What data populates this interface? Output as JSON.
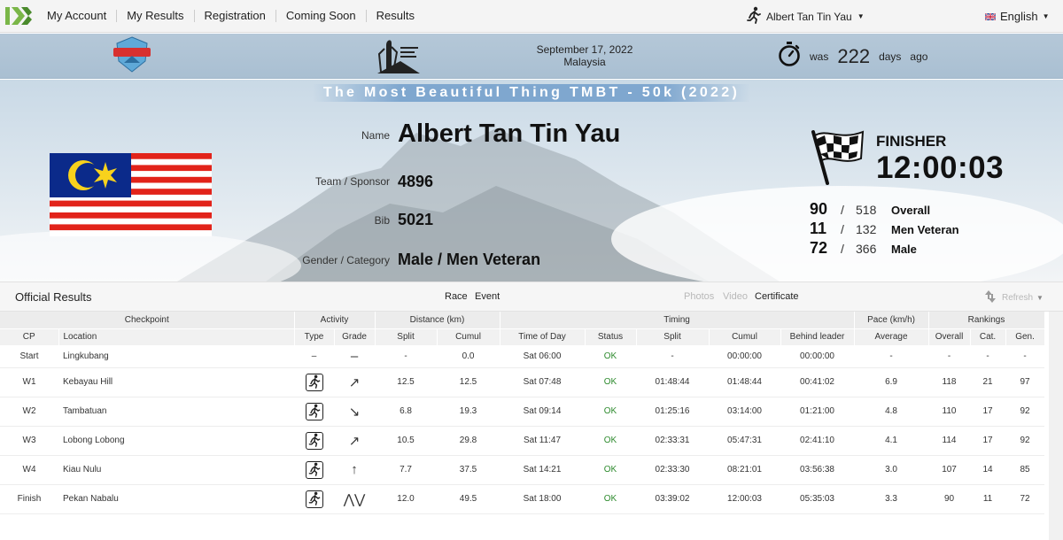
{
  "nav": {
    "items": [
      "My Account",
      "My Results",
      "Registration",
      "Coming Soon",
      "Results"
    ],
    "user_name": "Albert Tan Tin Yau",
    "language": "English"
  },
  "header": {
    "date": "September 17, 2022",
    "country": "Malaysia",
    "was_label": "was",
    "days_count": "222",
    "days_label": "days",
    "ago_label": "ago"
  },
  "event_title": "The Most Beautiful Thing TMBT - 50k (2022)",
  "runner": {
    "name_label": "Name",
    "name": "Albert Tan Tin Yau",
    "team_label": "Team / Sponsor",
    "team": "4896",
    "bib_label": "Bib",
    "bib": "5021",
    "gender_label": "Gender / Category",
    "gender": "Male / Men Veteran"
  },
  "finish": {
    "status": "FINISHER",
    "time": "12:00:03",
    "rankings": [
      {
        "pos": "90",
        "total": "518",
        "category": "Overall"
      },
      {
        "pos": "11",
        "total": "132",
        "category": "Men Veteran"
      },
      {
        "pos": "72",
        "total": "366",
        "category": "Male"
      }
    ]
  },
  "results_bar": {
    "title": "Official Results",
    "tab_race": "Race",
    "tab_event": "Event",
    "tab_photos": "Photos",
    "tab_video": "Video",
    "tab_certificate": "Certificate",
    "refresh": "Refresh"
  },
  "table": {
    "group_headers": [
      "Checkpoint",
      "Activity",
      "Distance (km)",
      "Timing",
      "Pace (km/h)",
      "Rankings"
    ],
    "columns": [
      "CP",
      "Location",
      "Type",
      "Grade",
      "Split",
      "Cumul",
      "Time of Day",
      "Status",
      "Split",
      "Cumul",
      "Behind leader",
      "Average",
      "Overall",
      "Cat.",
      "Gen."
    ],
    "rows": [
      {
        "cp": "Start",
        "location": "Lingkubang",
        "type": "–",
        "grade": "–",
        "dist_split": "-",
        "dist_cumul": "0.0",
        "tod": "Sat 06:00",
        "status": "OK",
        "split": "-",
        "cumul": "00:00:00",
        "behind": "00:00:00",
        "pace": "-",
        "overall": "-",
        "cat": "-",
        "gen": "-"
      },
      {
        "cp": "W1",
        "location": "Kebayau Hill",
        "type": "runner-icon",
        "grade": "↗",
        "dist_split": "12.5",
        "dist_cumul": "12.5",
        "tod": "Sat 07:48",
        "status": "OK",
        "split": "01:48:44",
        "cumul": "01:48:44",
        "behind": "00:41:02",
        "pace": "6.9",
        "overall": "118",
        "cat": "21",
        "gen": "97"
      },
      {
        "cp": "W2",
        "location": "Tambatuan",
        "type": "runner-icon",
        "grade": "↘",
        "dist_split": "6.8",
        "dist_cumul": "19.3",
        "tod": "Sat 09:14",
        "status": "OK",
        "split": "01:25:16",
        "cumul": "03:14:00",
        "behind": "01:21:00",
        "pace": "4.8",
        "overall": "110",
        "cat": "17",
        "gen": "92"
      },
      {
        "cp": "W3",
        "location": "Lobong Lobong",
        "type": "runner-icon",
        "grade": "↗",
        "dist_split": "10.5",
        "dist_cumul": "29.8",
        "tod": "Sat 11:47",
        "status": "OK",
        "split": "02:33:31",
        "cumul": "05:47:31",
        "behind": "02:41:10",
        "pace": "4.1",
        "overall": "114",
        "cat": "17",
        "gen": "92"
      },
      {
        "cp": "W4",
        "location": "Kiau Nulu",
        "type": "runner-icon",
        "grade": "↑",
        "dist_split": "7.7",
        "dist_cumul": "37.5",
        "tod": "Sat 14:21",
        "status": "OK",
        "split": "02:33:30",
        "cumul": "08:21:01",
        "behind": "03:56:38",
        "pace": "3.0",
        "overall": "107",
        "cat": "14",
        "gen": "85"
      },
      {
        "cp": "Finish",
        "location": "Pekan Nabalu",
        "type": "runner-icon",
        "grade": "⋀⋁",
        "dist_split": "12.0",
        "dist_cumul": "49.5",
        "tod": "Sat 18:00",
        "status": "OK",
        "split": "03:39:02",
        "cumul": "12:00:03",
        "behind": "05:35:03",
        "pace": "3.3",
        "overall": "90",
        "cat": "11",
        "gen": "72"
      }
    ]
  },
  "colors": {
    "ok_status": "#2e8b2e",
    "header_band": "#b5c8d8",
    "title_banner": "#7fa7cf"
  }
}
